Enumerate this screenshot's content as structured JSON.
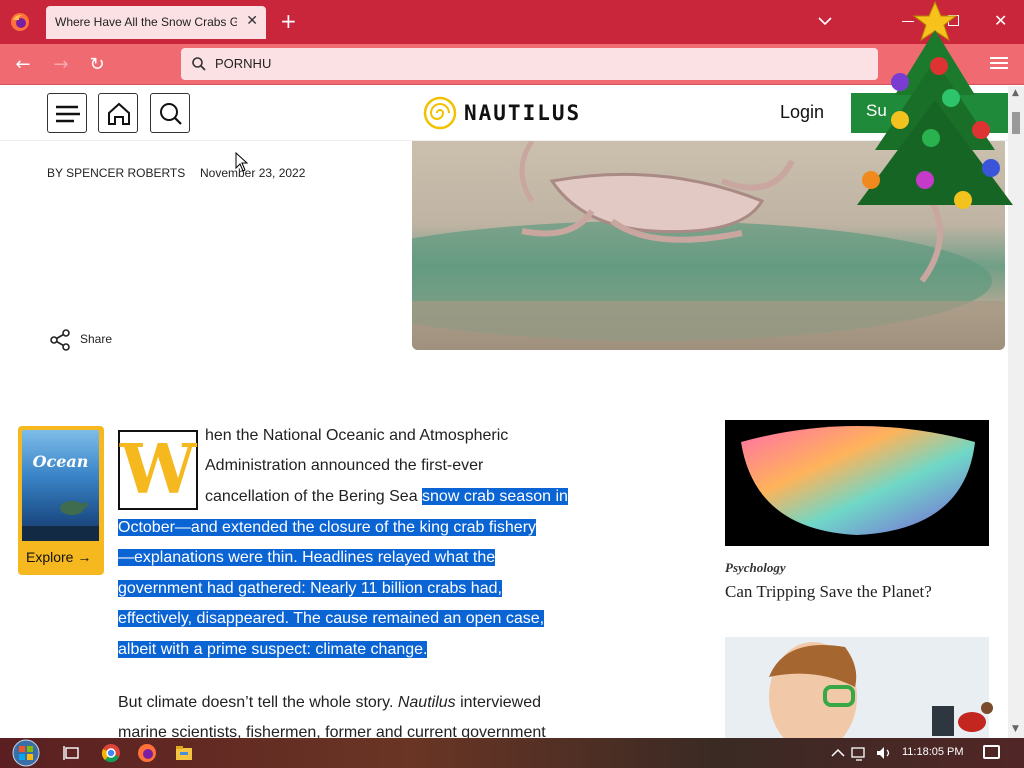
{
  "browser": {
    "tab_title": "Where Have All the Snow Crabs Gone?",
    "tab_close": "✕",
    "new_tab": "+",
    "url": "PORNHU"
  },
  "site": {
    "logo_text": "NAUTILUS",
    "login_label": "Login",
    "subscribe_label": "Su"
  },
  "article": {
    "byline": "BY SPENCER ROBERTS",
    "date": "November 23, 2022",
    "share_label": "Share",
    "dropcap": "W",
    "lines": [
      {
        "text": "hen the National Oceanic and Atmospheric",
        "highlight": ""
      },
      {
        "text": "Administration announced the first-ever",
        "highlight": ""
      },
      {
        "text": "cancellation of the Bering Sea ",
        "highlight": "snow crab season in"
      },
      {
        "text": "",
        "highlight": "October—and extended the closure of the king crab fishery"
      },
      {
        "text": "",
        "highlight": "—explanations were thin. Headlines relayed what the"
      },
      {
        "text": "",
        "highlight": "government had gathered: Nearly 11 billion crabs had,"
      },
      {
        "text": "",
        "highlight": "effectively, disappeared. The cause remained an open case,"
      },
      {
        "text": "",
        "highlight": "albeit with a prime suspect: climate change."
      }
    ],
    "para2_line1_a": "But climate doesn’t tell the whole story. ",
    "para2_line1_b": "Nautilus",
    "para2_line1_c": " interviewed",
    "para2_line2": "marine scientists, fishermen, former and current government"
  },
  "promo": {
    "cover_title": "Ocean",
    "explore_label": "Explore →"
  },
  "sidebar": {
    "category": "Psychology",
    "title": "Can Tripping Save the Planet?"
  },
  "taskbar": {
    "clock": "11:18:05 PM"
  }
}
